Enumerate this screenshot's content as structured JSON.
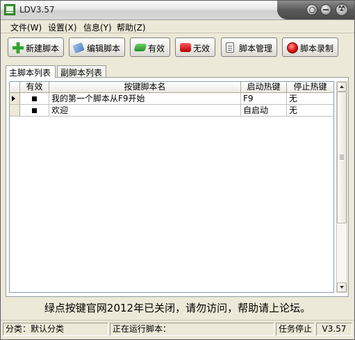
{
  "window": {
    "title": "LDV3.57"
  },
  "menu": [
    {
      "label": "文件(W)"
    },
    {
      "label": "设置(X)"
    },
    {
      "label": "信息(Y)"
    },
    {
      "label": "帮助(Z)"
    }
  ],
  "toolbar": {
    "new_script": "新建脚本",
    "edit_script": "编辑脚本",
    "valid": "有效",
    "invalid": "无效",
    "manage_script": "脚本管理",
    "record_script": "脚本录制"
  },
  "tabs": [
    {
      "label": "主脚本列表",
      "active": true
    },
    {
      "label": "副脚本列表",
      "active": false
    }
  ],
  "table": {
    "headers": [
      "有效",
      "按键脚本名",
      "启动热键",
      "停止热键"
    ],
    "rows": [
      {
        "enabled": true,
        "name": "我的第一个脚本从F9开始",
        "start_hotkey": "F9",
        "stop_hotkey": "无",
        "current": true
      },
      {
        "enabled": true,
        "name": "欢迎",
        "start_hotkey": "自启动",
        "stop_hotkey": "无",
        "current": false
      }
    ]
  },
  "notice": "绿点按键官网2012年已关闭，请勿访问，帮助请上论坛。",
  "status": {
    "category": "分类：默认分类",
    "running": "正在运行脚本：",
    "task": "任务停止",
    "version": "V3.57"
  }
}
